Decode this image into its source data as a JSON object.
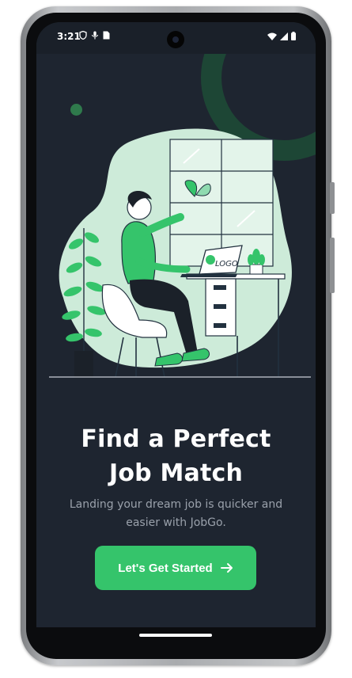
{
  "status_bar": {
    "time": "3:21",
    "icons_left": [
      "shield-icon",
      "mic-icon",
      "sim-card-icon"
    ],
    "icons_right": [
      "wifi-icon",
      "signal-icon",
      "battery-icon"
    ]
  },
  "onboarding": {
    "title_line1": "Find a Perfect",
    "title_line2": "Job Match",
    "subtitle": "Landing your dream job is quicker and easier with JobGo.",
    "cta_label": "Let's Get Started",
    "cta_icon": "arrow-right-icon",
    "illustration_logo_text": "LOGO"
  },
  "colors": {
    "background": "#1e2530",
    "accent": "#35c46b",
    "illustration_blob": "#cdebd9",
    "text_primary": "#ffffff",
    "text_secondary": "#9aa1ab"
  }
}
